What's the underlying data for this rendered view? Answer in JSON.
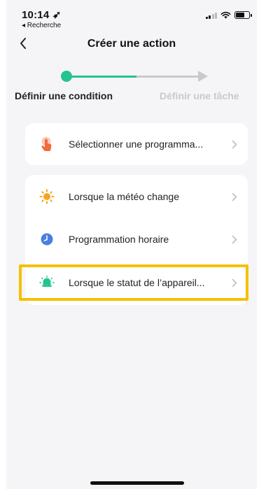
{
  "status_bar": {
    "time": "10:14 ➶",
    "back_app": "◂ Recherche"
  },
  "nav": {
    "title": "Créer une action",
    "back_icon": "chevron-left-icon"
  },
  "stepper": {
    "step1_label": "Définir une condition",
    "step2_label": "Définir une tâche",
    "active_color": "#23c48e",
    "inactive_color": "#c9c9cd"
  },
  "group1": {
    "items": [
      {
        "label": "Sélectionner une programma...",
        "icon": "hand-pointer-icon",
        "color": "#f26b3a"
      }
    ]
  },
  "group2": {
    "items": [
      {
        "label": "Lorsque la météo change",
        "icon": "sun-icon",
        "color": "#f7a51c"
      },
      {
        "label": "Programmation horaire",
        "icon": "clock-icon",
        "color": "#4a7fe0"
      },
      {
        "label": "Lorsque le statut de l’appareil...",
        "icon": "device-status-icon",
        "color": "#23c48e"
      }
    ]
  },
  "highlight_color": "#f6c000"
}
